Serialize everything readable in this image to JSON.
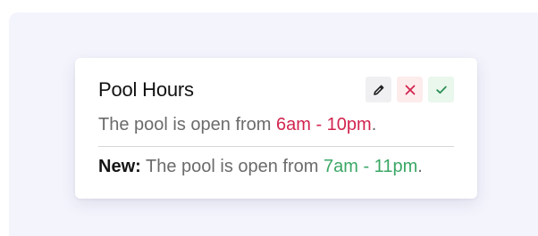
{
  "card": {
    "title": "Pool Hours",
    "current": {
      "prefix": "The pool is open from ",
      "time": "6am - 10pm",
      "suffix": "."
    },
    "proposed": {
      "label": "New:",
      "prefix": " The pool is open from ",
      "time": "7am - 11pm",
      "suffix": "."
    },
    "actions": [
      {
        "name": "edit",
        "icon": "pencil-icon"
      },
      {
        "name": "reject",
        "icon": "close-icon"
      },
      {
        "name": "approve",
        "icon": "check-icon"
      }
    ]
  },
  "colors": {
    "backdrop": "#f4f4fd",
    "old_time": "#d2254f",
    "new_time": "#3aa765",
    "reject_bg": "#fdecec",
    "approve_bg": "#e9f7ed",
    "edit_bg": "#f0f0f2"
  }
}
